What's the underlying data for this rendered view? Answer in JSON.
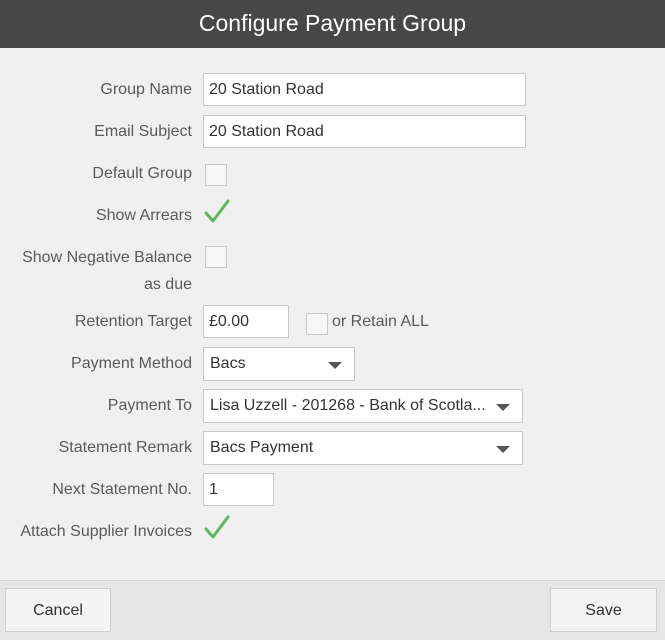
{
  "dialog": {
    "title": "Configure Payment Group"
  },
  "form": {
    "group_name": {
      "label": "Group Name",
      "value": "20 Station Road"
    },
    "email_subject": {
      "label": "Email Subject",
      "value": "20 Station Road"
    },
    "default_group": {
      "label": "Default Group",
      "checked": false
    },
    "show_arrears": {
      "label": "Show Arrears",
      "checked": true
    },
    "show_negative_balance": {
      "label": "Show Negative Balance as due",
      "checked": false
    },
    "retention_target": {
      "label": "Retention Target",
      "value": "£0.00",
      "retain_all_label": "or Retain ALL",
      "retain_all_checked": false
    },
    "payment_method": {
      "label": "Payment Method",
      "value": "Bacs"
    },
    "payment_to": {
      "label": "Payment To",
      "value": "Lisa Uzzell - 201268 - Bank of Scotla..."
    },
    "statement_remark": {
      "label": "Statement Remark",
      "value": "Bacs Payment"
    },
    "next_statement_no": {
      "label": "Next Statement No.",
      "value": "1"
    },
    "attach_supplier_invoices": {
      "label": "Attach Supplier Invoices",
      "checked": true
    }
  },
  "footer": {
    "cancel_label": "Cancel",
    "save_label": "Save"
  },
  "colors": {
    "titlebar": "#474747",
    "check": "#5cb85c",
    "background": "#f0f0f0"
  }
}
